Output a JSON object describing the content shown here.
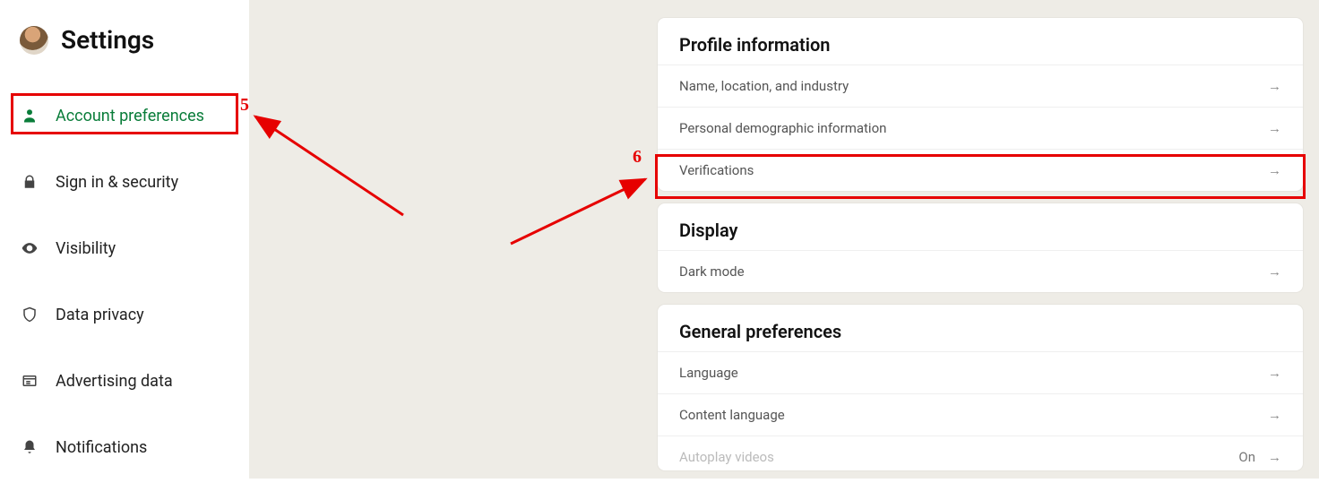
{
  "sidebar": {
    "title": "Settings",
    "items": [
      {
        "label": "Account preferences"
      },
      {
        "label": "Sign in & security"
      },
      {
        "label": "Visibility"
      },
      {
        "label": "Data privacy"
      },
      {
        "label": "Advertising data"
      },
      {
        "label": "Notifications"
      }
    ]
  },
  "content": {
    "sections": [
      {
        "header": "Profile information",
        "rows": [
          {
            "label": "Name, location, and industry"
          },
          {
            "label": "Personal demographic information"
          },
          {
            "label": "Verifications"
          }
        ]
      },
      {
        "header": "Display",
        "rows": [
          {
            "label": "Dark mode"
          }
        ]
      },
      {
        "header": "General preferences",
        "rows": [
          {
            "label": "Language"
          },
          {
            "label": "Content language"
          },
          {
            "label": "Autoplay videos",
            "value": "On"
          }
        ]
      }
    ]
  },
  "annotations": {
    "label5": "5",
    "label6": "6"
  }
}
